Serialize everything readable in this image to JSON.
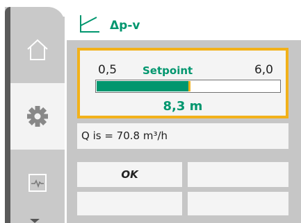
{
  "header": {
    "mode_label": "Δp-v",
    "mode_icon": "proportional-pressure-curve-icon"
  },
  "nav": {
    "items": [
      {
        "id": "home",
        "icon": "home-icon",
        "selected": false
      },
      {
        "id": "settings",
        "icon": "gear-icon",
        "selected": true
      },
      {
        "id": "diagnostics",
        "icon": "diagnostics-icon",
        "selected": false
      }
    ],
    "scroll_icon": "chevron-down-icon"
  },
  "setpoint": {
    "label": "Setpoint",
    "min_label": "0,5",
    "max_label": "6,0",
    "min": 0.5,
    "max": 6.0,
    "value_label": "8,3 m",
    "fill_fraction": 0.5
  },
  "info": {
    "flow_text": "Q is = 70.8 m³/h"
  },
  "buttons": {
    "ok_label": "OK"
  },
  "colors": {
    "accent_green": "#00966e",
    "focus_orange": "#f2b11a",
    "rail_gray": "#c9c9c9",
    "panel_gray": "#c6c6c6"
  }
}
